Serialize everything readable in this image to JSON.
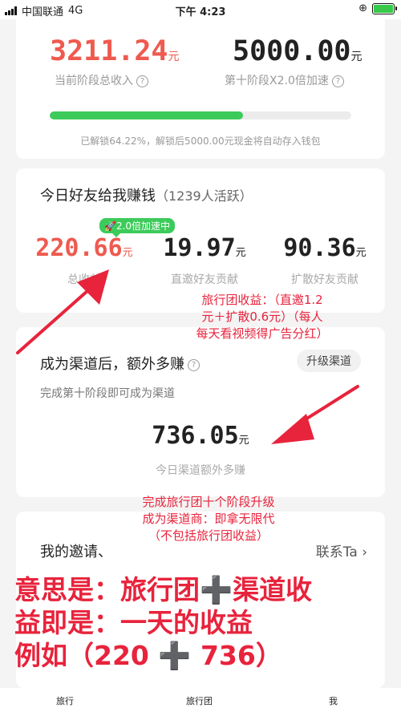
{
  "status_bar": {
    "carrier": "中国联通",
    "network": "4G",
    "time": "下午 4:23",
    "battery_percent": 100
  },
  "stage": {
    "income_value": "3211.24",
    "income_unit": "元",
    "income_label": "当前阶段总收入",
    "bonus_value": "5000.00",
    "bonus_unit": "元",
    "bonus_label": "第十阶段X2.0倍加速",
    "progress_percent": 64.22,
    "unlock_note": "已解锁64.22%，解锁后5000.00元现金将自动存入钱包"
  },
  "friends": {
    "title": "今日好友给我赚钱",
    "active_note": "（1239人活跃）",
    "boost_badge": "2.0倍加速中",
    "stats": [
      {
        "value": "220.66",
        "unit": "元",
        "label": "总收益"
      },
      {
        "value": "19.97",
        "unit": "元",
        "label": "直邀好友贡献"
      },
      {
        "value": "90.36",
        "unit": "元",
        "label": "扩散好友贡献"
      }
    ]
  },
  "channel": {
    "title": "成为渠道后，额外多赚",
    "upgrade_button": "升级渠道",
    "subtitle": "完成第十阶段即可成为渠道",
    "value": "736.05",
    "unit": "元",
    "value_label": "今日渠道额外多赚"
  },
  "invite": {
    "title": "我的邀请",
    "contact_link": "联系Ta"
  },
  "annotations": {
    "note1": [
      "旅行团收益：（直邀1.2",
      "元＋扩散0.6元）（每人",
      "每天看视频得广告分红）"
    ],
    "note2": [
      "完成旅行团十个阶段升级",
      "成为渠道商：即拿无限代",
      "（不包括旅行团收益）"
    ],
    "note3": [
      "意思是：旅行团➕渠道收",
      "益即是：一天的收益",
      "例如（220 ➕ 736）"
    ]
  },
  "tabs": [
    "旅行",
    "旅行团",
    "我"
  ],
  "colors": {
    "accent_red": "#e8233c",
    "progress_green": "#3ccb5a",
    "stage_income_red": "#ef5a4f"
  }
}
